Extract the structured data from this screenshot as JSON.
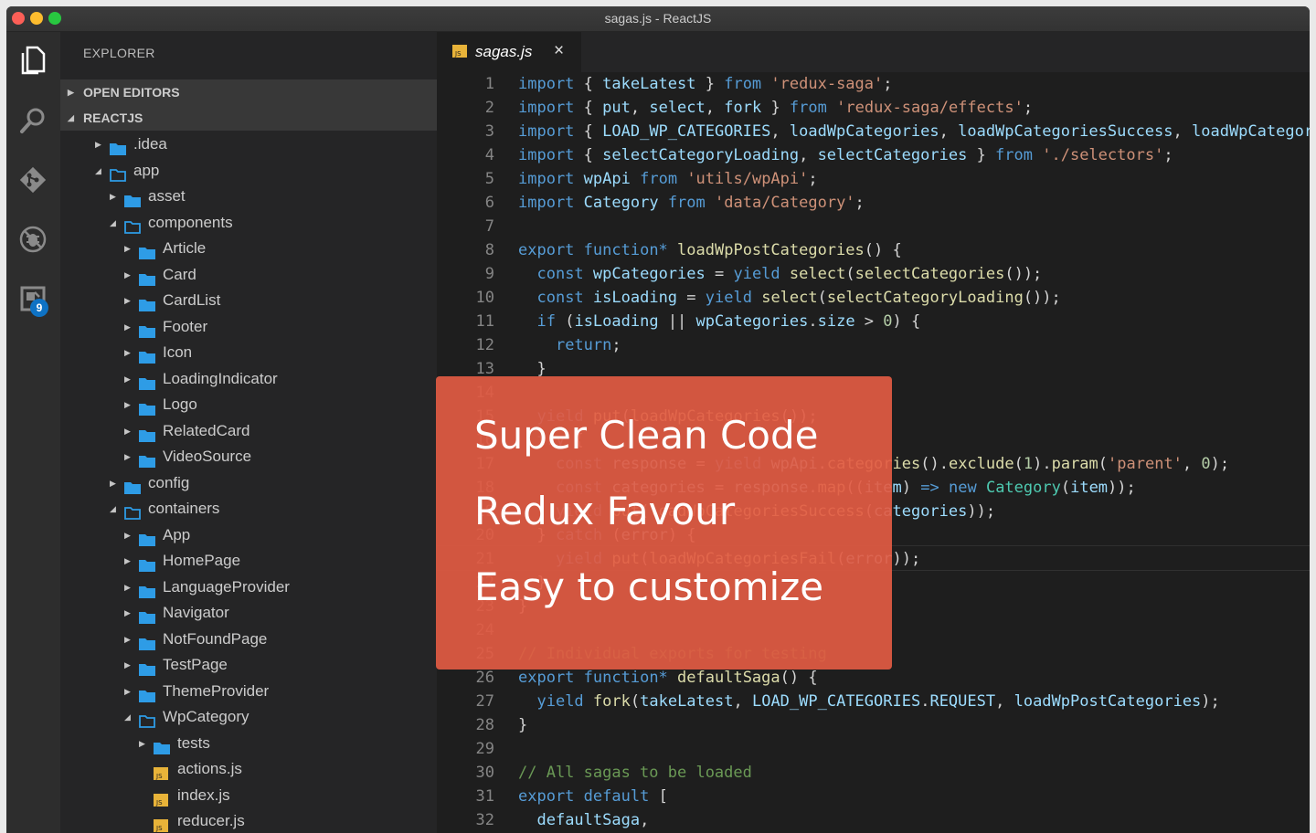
{
  "window": {
    "title": "sagas.js - ReactJS"
  },
  "activity_bar": {
    "source_control_badge": "9"
  },
  "sidebar": {
    "title": "EXPLORER",
    "sections": [
      "OPEN EDITORS",
      "REACTJS"
    ],
    "tree": [
      {
        "label": ".idea",
        "type": "folder",
        "depth": 1,
        "expanded": false
      },
      {
        "label": "app",
        "type": "folder",
        "depth": 1,
        "expanded": true
      },
      {
        "label": "asset",
        "type": "folder",
        "depth": 2,
        "expanded": false
      },
      {
        "label": "components",
        "type": "folder",
        "depth": 2,
        "expanded": true
      },
      {
        "label": "Article",
        "type": "folder",
        "depth": 3,
        "expanded": false
      },
      {
        "label": "Card",
        "type": "folder",
        "depth": 3,
        "expanded": false
      },
      {
        "label": "CardList",
        "type": "folder",
        "depth": 3,
        "expanded": false
      },
      {
        "label": "Footer",
        "type": "folder",
        "depth": 3,
        "expanded": false
      },
      {
        "label": "Icon",
        "type": "folder",
        "depth": 3,
        "expanded": false
      },
      {
        "label": "LoadingIndicator",
        "type": "folder",
        "depth": 3,
        "expanded": false
      },
      {
        "label": "Logo",
        "type": "folder",
        "depth": 3,
        "expanded": false
      },
      {
        "label": "RelatedCard",
        "type": "folder",
        "depth": 3,
        "expanded": false
      },
      {
        "label": "VideoSource",
        "type": "folder",
        "depth": 3,
        "expanded": false
      },
      {
        "label": "config",
        "type": "folder",
        "depth": 2,
        "expanded": false
      },
      {
        "label": "containers",
        "type": "folder",
        "depth": 2,
        "expanded": true
      },
      {
        "label": "App",
        "type": "folder",
        "depth": 3,
        "expanded": false
      },
      {
        "label": "HomePage",
        "type": "folder",
        "depth": 3,
        "expanded": false
      },
      {
        "label": "LanguageProvider",
        "type": "folder",
        "depth": 3,
        "expanded": false
      },
      {
        "label": "Navigator",
        "type": "folder",
        "depth": 3,
        "expanded": false
      },
      {
        "label": "NotFoundPage",
        "type": "folder",
        "depth": 3,
        "expanded": false
      },
      {
        "label": "TestPage",
        "type": "folder",
        "depth": 3,
        "expanded": false
      },
      {
        "label": "ThemeProvider",
        "type": "folder",
        "depth": 3,
        "expanded": false
      },
      {
        "label": "WpCategory",
        "type": "folder",
        "depth": 3,
        "expanded": true
      },
      {
        "label": "tests",
        "type": "folder",
        "depth": 4,
        "expanded": false
      },
      {
        "label": "actions.js",
        "type": "js",
        "depth": 4
      },
      {
        "label": "index.js",
        "type": "js",
        "depth": 4
      },
      {
        "label": "reducer.js",
        "type": "js",
        "depth": 4
      }
    ]
  },
  "editor": {
    "tab": {
      "file_icon": "JS",
      "label": "sagas.js",
      "close": "×"
    },
    "lines": [
      [
        [
          "k",
          "import"
        ],
        [
          "p",
          " { "
        ],
        [
          "v",
          "takeLatest"
        ],
        [
          "p",
          " } "
        ],
        [
          "k",
          "from"
        ],
        [
          "p",
          " "
        ],
        [
          "s",
          "'redux-saga'"
        ],
        [
          "p",
          ";"
        ]
      ],
      [
        [
          "k",
          "import"
        ],
        [
          "p",
          " { "
        ],
        [
          "v",
          "put"
        ],
        [
          "p",
          ", "
        ],
        [
          "v",
          "select"
        ],
        [
          "p",
          ", "
        ],
        [
          "v",
          "fork"
        ],
        [
          "p",
          " } "
        ],
        [
          "k",
          "from"
        ],
        [
          "p",
          " "
        ],
        [
          "s",
          "'redux-saga/effects'"
        ],
        [
          "p",
          ";"
        ]
      ],
      [
        [
          "k",
          "import"
        ],
        [
          "p",
          " { "
        ],
        [
          "v",
          "LOAD_WP_CATEGORIES"
        ],
        [
          "p",
          ", "
        ],
        [
          "v",
          "loadWpCategories"
        ],
        [
          "p",
          ", "
        ],
        [
          "v",
          "loadWpCategoriesSuccess"
        ],
        [
          "p",
          ", "
        ],
        [
          "v",
          "loadWpCategori"
        ]
      ],
      [
        [
          "k",
          "import"
        ],
        [
          "p",
          " { "
        ],
        [
          "v",
          "selectCategoryLoading"
        ],
        [
          "p",
          ", "
        ],
        [
          "v",
          "selectCategories"
        ],
        [
          "p",
          " } "
        ],
        [
          "k",
          "from"
        ],
        [
          "p",
          " "
        ],
        [
          "s",
          "'./selectors'"
        ],
        [
          "p",
          ";"
        ]
      ],
      [
        [
          "k",
          "import"
        ],
        [
          "p",
          " "
        ],
        [
          "v",
          "wpApi"
        ],
        [
          "p",
          " "
        ],
        [
          "k",
          "from"
        ],
        [
          "p",
          " "
        ],
        [
          "s",
          "'utils/wpApi'"
        ],
        [
          "p",
          ";"
        ]
      ],
      [
        [
          "k",
          "import"
        ],
        [
          "p",
          " "
        ],
        [
          "v",
          "Category"
        ],
        [
          "p",
          " "
        ],
        [
          "k",
          "from"
        ],
        [
          "p",
          " "
        ],
        [
          "s",
          "'data/Category'"
        ],
        [
          "p",
          ";"
        ]
      ],
      [],
      [
        [
          "k",
          "export"
        ],
        [
          "p",
          " "
        ],
        [
          "k",
          "function*"
        ],
        [
          "p",
          " "
        ],
        [
          "f",
          "loadWpPostCategories"
        ],
        [
          "p",
          "() {"
        ]
      ],
      [
        [
          "p",
          "  "
        ],
        [
          "k",
          "const"
        ],
        [
          "p",
          " "
        ],
        [
          "v",
          "wpCategories"
        ],
        [
          "p",
          " = "
        ],
        [
          "k",
          "yield"
        ],
        [
          "p",
          " "
        ],
        [
          "f",
          "select"
        ],
        [
          "p",
          "("
        ],
        [
          "f",
          "selectCategories"
        ],
        [
          "p",
          "());"
        ]
      ],
      [
        [
          "p",
          "  "
        ],
        [
          "k",
          "const"
        ],
        [
          "p",
          " "
        ],
        [
          "v",
          "isLoading"
        ],
        [
          "p",
          " = "
        ],
        [
          "k",
          "yield"
        ],
        [
          "p",
          " "
        ],
        [
          "f",
          "select"
        ],
        [
          "p",
          "("
        ],
        [
          "f",
          "selectCategoryLoading"
        ],
        [
          "p",
          "());"
        ]
      ],
      [
        [
          "p",
          "  "
        ],
        [
          "k",
          "if"
        ],
        [
          "p",
          " ("
        ],
        [
          "v",
          "isLoading"
        ],
        [
          "p",
          " || "
        ],
        [
          "v",
          "wpCategories"
        ],
        [
          "p",
          "."
        ],
        [
          "v",
          "size"
        ],
        [
          "p",
          " > "
        ],
        [
          "n",
          "0"
        ],
        [
          "p",
          ") {"
        ]
      ],
      [
        [
          "p",
          "    "
        ],
        [
          "k",
          "return"
        ],
        [
          "p",
          ";"
        ]
      ],
      [
        [
          "p",
          "  }"
        ]
      ],
      [],
      [
        [
          "p",
          "  "
        ],
        [
          "k",
          "yield"
        ],
        [
          "p",
          " "
        ],
        [
          "f",
          "put"
        ],
        [
          "p",
          "("
        ],
        [
          "f",
          "loadWpCategories"
        ],
        [
          "p",
          "());"
        ]
      ],
      [
        [
          "p",
          "  "
        ],
        [
          "k",
          "try"
        ],
        [
          "p",
          " {"
        ]
      ],
      [
        [
          "p",
          "    "
        ],
        [
          "k",
          "const"
        ],
        [
          "p",
          " "
        ],
        [
          "v",
          "response"
        ],
        [
          "p",
          " = "
        ],
        [
          "k",
          "yield"
        ],
        [
          "p",
          " "
        ],
        [
          "v",
          "wpApi"
        ],
        [
          "p",
          "."
        ],
        [
          "f",
          "categories"
        ],
        [
          "p",
          "()."
        ],
        [
          "f",
          "exclude"
        ],
        [
          "p",
          "("
        ],
        [
          "n",
          "1"
        ],
        [
          "p",
          ")."
        ],
        [
          "f",
          "param"
        ],
        [
          "p",
          "("
        ],
        [
          "s",
          "'parent'"
        ],
        [
          "p",
          ", "
        ],
        [
          "n",
          "0"
        ],
        [
          "p",
          ");"
        ]
      ],
      [
        [
          "p",
          "    "
        ],
        [
          "k",
          "const"
        ],
        [
          "p",
          " "
        ],
        [
          "v",
          "categories"
        ],
        [
          "p",
          " = "
        ],
        [
          "v",
          "response"
        ],
        [
          "p",
          "."
        ],
        [
          "f",
          "map"
        ],
        [
          "p",
          "(("
        ],
        [
          "v",
          "item"
        ],
        [
          "p",
          ") "
        ],
        [
          "k",
          "=>"
        ],
        [
          "p",
          " "
        ],
        [
          "k",
          "new"
        ],
        [
          "p",
          " "
        ],
        [
          "t",
          "Category"
        ],
        [
          "p",
          "("
        ],
        [
          "v",
          "item"
        ],
        [
          "p",
          "));"
        ]
      ],
      [
        [
          "p",
          "    "
        ],
        [
          "k",
          "yield"
        ],
        [
          "p",
          " "
        ],
        [
          "f",
          "put"
        ],
        [
          "p",
          "("
        ],
        [
          "f",
          "loadWpCategoriesSuccess"
        ],
        [
          "p",
          "("
        ],
        [
          "v",
          "categories"
        ],
        [
          "p",
          "));"
        ]
      ],
      [
        [
          "p",
          "  } "
        ],
        [
          "k",
          "catch"
        ],
        [
          "p",
          " ("
        ],
        [
          "v",
          "error"
        ],
        [
          "p",
          ") {"
        ]
      ],
      [
        [
          "p",
          "    "
        ],
        [
          "k",
          "yield"
        ],
        [
          "p",
          " "
        ],
        [
          "f",
          "put"
        ],
        [
          "p",
          "("
        ],
        [
          "f",
          "loadWpCategoriesFail"
        ],
        [
          "p",
          "("
        ],
        [
          "v",
          "error"
        ],
        [
          "p",
          "));"
        ]
      ],
      [
        [
          "p",
          "  }"
        ]
      ],
      [
        [
          "p",
          "}"
        ]
      ],
      [],
      [
        [
          "c",
          "// Individual exports for testing"
        ]
      ],
      [
        [
          "k",
          "export"
        ],
        [
          "p",
          " "
        ],
        [
          "k",
          "function*"
        ],
        [
          "p",
          " "
        ],
        [
          "f",
          "defaultSaga"
        ],
        [
          "p",
          "() {"
        ]
      ],
      [
        [
          "p",
          "  "
        ],
        [
          "k",
          "yield"
        ],
        [
          "p",
          " "
        ],
        [
          "f",
          "fork"
        ],
        [
          "p",
          "("
        ],
        [
          "v",
          "takeLatest"
        ],
        [
          "p",
          ", "
        ],
        [
          "v",
          "LOAD_WP_CATEGORIES"
        ],
        [
          "p",
          "."
        ],
        [
          "v",
          "REQUEST"
        ],
        [
          "p",
          ", "
        ],
        [
          "v",
          "loadWpPostCategories"
        ],
        [
          "p",
          ");"
        ]
      ],
      [
        [
          "p",
          "}"
        ]
      ],
      [],
      [
        [
          "c",
          "// All sagas to be loaded"
        ]
      ],
      [
        [
          "k",
          "export"
        ],
        [
          "p",
          " "
        ],
        [
          "k",
          "default"
        ],
        [
          "p",
          " ["
        ]
      ],
      [
        [
          "p",
          "  "
        ],
        [
          "v",
          "defaultSaga"
        ],
        [
          "p",
          ","
        ]
      ]
    ]
  },
  "overlay": {
    "lines": [
      "Super Clean Code",
      "Redux Favour",
      "Easy to customize"
    ],
    "color": "#e25b43"
  }
}
